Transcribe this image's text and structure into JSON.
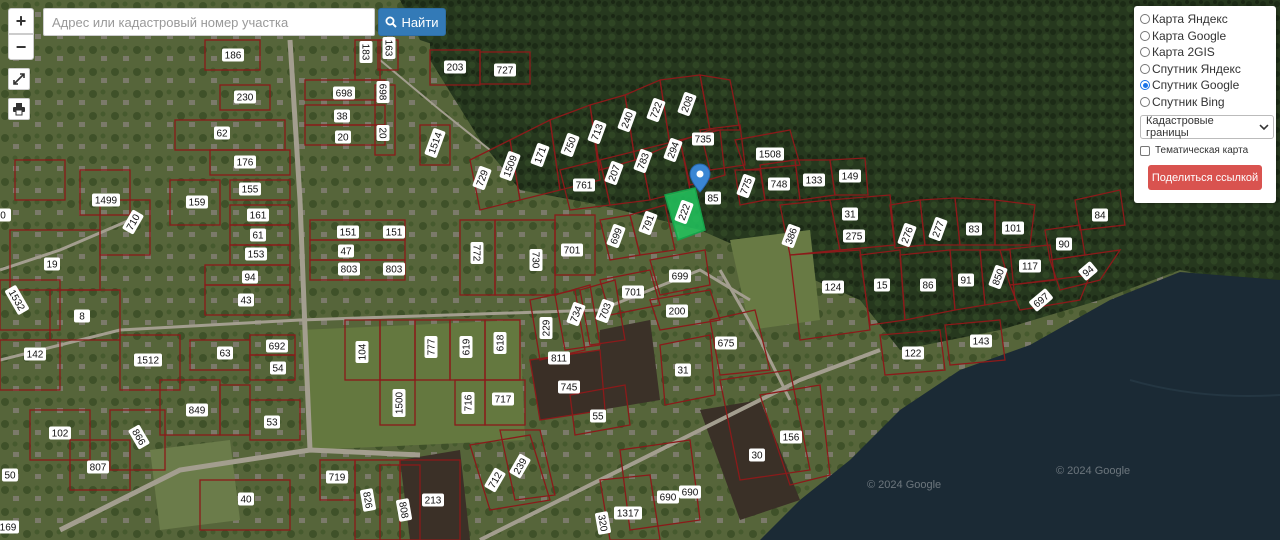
{
  "search": {
    "placeholder": "Адрес или кадастровый номер участка",
    "button_label": "Найти"
  },
  "controls": {
    "zoom_in": "+",
    "zoom_out": "−"
  },
  "layers": {
    "options": [
      {
        "label": "Карта Яндекс",
        "selected": false
      },
      {
        "label": "Карта Google",
        "selected": false
      },
      {
        "label": "Карта 2GIS",
        "selected": false
      },
      {
        "label": "Спутник Яндекс",
        "selected": false
      },
      {
        "label": "Спутник Google",
        "selected": true
      },
      {
        "label": "Спутник Bing",
        "selected": false
      }
    ],
    "boundary_select": "Кадастровые границы",
    "thematic_label": "Тематическая карта",
    "share_label": "Поделиться ссылкой"
  },
  "copyrights": [
    "© 2024 Google",
    "© 2024 Google"
  ],
  "colors": {
    "parcel_border": "#8b1a1a",
    "highlighted_parcel": "#22c55e",
    "marker": "#3a86d4",
    "water": "#1b2a35",
    "forest": "#27391f",
    "field": "#5d7040"
  },
  "parcel_labels": [
    "186",
    "203",
    "727",
    "183",
    "163",
    "230",
    "698",
    "38",
    "20",
    "698",
    "20",
    "62",
    "176",
    "155",
    "1514",
    "1499",
    "159",
    "161",
    "151",
    "151",
    "710",
    "19",
    "61",
    "153",
    "47",
    "803",
    "803",
    "94",
    "43",
    "1532",
    "8",
    "1512",
    "63",
    "692",
    "142",
    "54",
    "102",
    "849",
    "53",
    "866",
    "807",
    "719",
    "40",
    "826",
    "213",
    "808",
    "772",
    "730",
    "701",
    "171",
    "750",
    "713",
    "240",
    "722",
    "208",
    "729",
    "1509",
    "761",
    "207",
    "783",
    "294",
    "735",
    "1508",
    "775",
    "748",
    "133",
    "149",
    "85",
    "222",
    "699",
    "791",
    "701",
    "699",
    "200",
    "675",
    "31",
    "104",
    "777",
    "619",
    "618",
    "229",
    "811",
    "745",
    "55",
    "716",
    "717",
    "1500",
    "734",
    "703",
    "386",
    "31",
    "275",
    "276",
    "277",
    "83",
    "101",
    "84",
    "90",
    "117",
    "94",
    "697",
    "124",
    "15",
    "86",
    "91",
    "850",
    "122",
    "143",
    "30",
    "156",
    "690",
    "1317",
    "320",
    "712",
    "239",
    "169",
    "0",
    "50",
    "690"
  ]
}
